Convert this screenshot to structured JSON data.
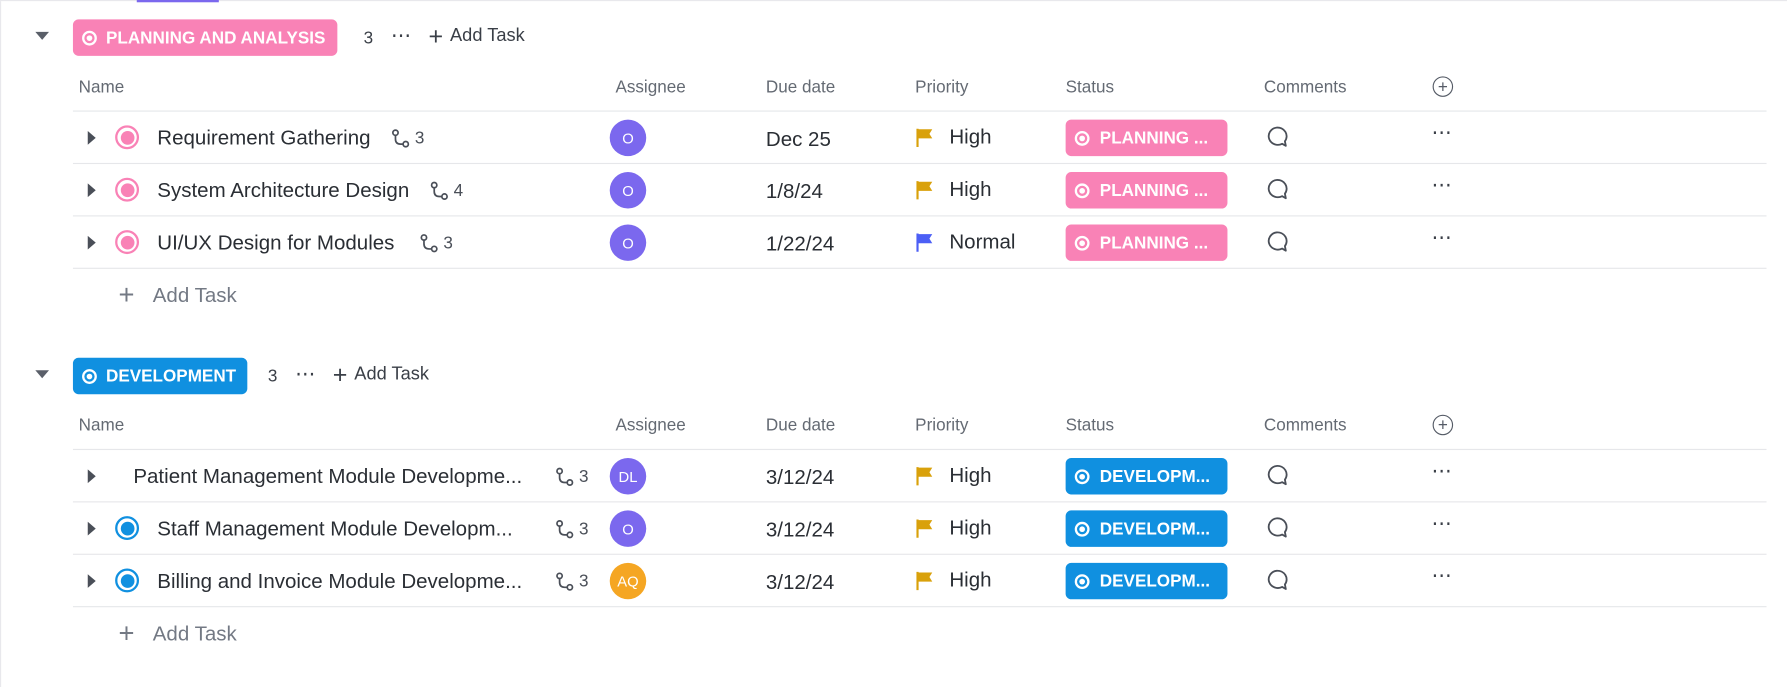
{
  "columns": {
    "name": "Name",
    "assignee": "Assignee",
    "due_date": "Due date",
    "priority": "Priority",
    "status": "Status",
    "comments": "Comments"
  },
  "add_task_label": "Add Task",
  "icons": {
    "collapse": "caret-down-icon",
    "expand": "caret-right-icon",
    "subtasks": "subtask-icon",
    "flag": "flag-icon",
    "comment": "comment-bubble-icon",
    "more": "more-dots-icon",
    "add_column": "plus-circle-icon"
  },
  "colors": {
    "planning": "#f982b6",
    "development": "#1090e0",
    "flag_high": "#d9a10b",
    "flag_normal": "#4c5ff5",
    "avatar_purple": "#7b68ee",
    "avatar_orange": "#f5a623"
  },
  "groups": [
    {
      "name": "PLANNING AND ANALYSIS",
      "count": "3",
      "tasks": [
        {
          "name": "Requirement Gathering",
          "subtasks": "3",
          "assignee": "O",
          "due": "Dec 25",
          "priority": "High",
          "status": "PLANNING ..."
        },
        {
          "name": "System Architecture Design",
          "subtasks": "4",
          "assignee": "O",
          "due": "1/8/24",
          "priority": "High",
          "status": "PLANNING ..."
        },
        {
          "name": "UI/UX Design for Modules",
          "subtasks": "3",
          "assignee": "O",
          "due": "1/22/24",
          "priority": "Normal",
          "status": "PLANNING ..."
        }
      ]
    },
    {
      "name": "DEVELOPMENT",
      "count": "3",
      "tasks": [
        {
          "name": "Patient Management Module Developme...",
          "subtasks": "3",
          "assignee": "DL",
          "due": "3/12/24",
          "priority": "High",
          "status": "DEVELOPM..."
        },
        {
          "name": "Staff Management Module Developm...",
          "subtasks": "3",
          "assignee": "O",
          "due": "3/12/24",
          "priority": "High",
          "status": "DEVELOPM..."
        },
        {
          "name": "Billing and Invoice Module Developme...",
          "subtasks": "3",
          "assignee": "AQ",
          "due": "3/12/24",
          "priority": "High",
          "status": "DEVELOPM..."
        }
      ]
    }
  ]
}
